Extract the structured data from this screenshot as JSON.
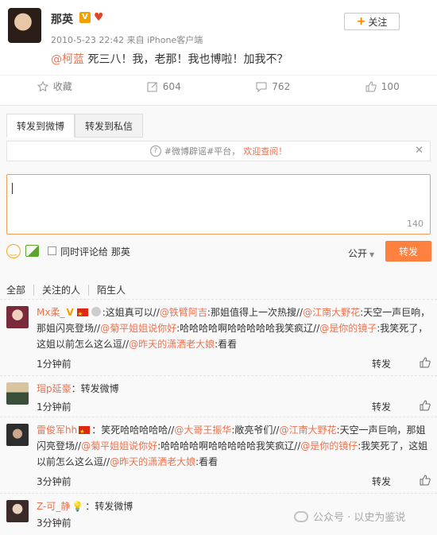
{
  "post": {
    "author": "那英",
    "verified_badge": "V",
    "meta": "2010-5-23 22:42 来自 iPhone客户端",
    "follow_label": "关注",
    "text_mention": "@柯蓝",
    "text_body": " 死三八！我，老那！我也博啦！加我不？"
  },
  "actions": {
    "favorite": "收藏",
    "repost_count": "604",
    "comment_count": "762",
    "like_count": "100"
  },
  "repost_panel": {
    "tab_weibo": "转发到微博",
    "tab_private": "转发到私信",
    "tip_prefix": "#微博辟谣#平台，",
    "tip_highlight": "欢迎查阅！",
    "counter": "140",
    "also_comment_label": "同时评论给 那英",
    "visibility": "公开",
    "submit_label": "转发"
  },
  "filters": [
    "全部",
    "关注的人",
    "陌生人"
  ],
  "comments": [
    {
      "user": "Mx柔_",
      "text": ":这姐真可以//",
      "mentions": [
        {
          "m": "@铁臂阿吉",
          "t": ":那姐值得上一次热搜//"
        },
        {
          "m": "@江南大野花",
          "t": ":天空一声巨响，那姐闪亮登场//"
        },
        {
          "m": "@菊平姐姐说你好",
          "t": ":哈哈哈哈啊哈哈哈哈哈我笑疯辽//"
        },
        {
          "m": "@是你的镜子",
          "t": ":我笑死了，这姐以前怎么这么逗//"
        },
        {
          "m": "@昨天的潇洒老大娘",
          "t": ":看看"
        }
      ],
      "time": "1分钟前",
      "forward": "转发"
    },
    {
      "user": "瑁p延豪",
      "text": "：转发微博",
      "time": "1分钟前",
      "forward": "转发"
    },
    {
      "user": "雷俊军hh",
      "text": "：笑死哈哈哈哈哈//",
      "mentions": [
        {
          "m": "@大哥王振华",
          "t": ":敞亮爷们//"
        },
        {
          "m": "@江南大野花",
          "t": ":天空一声巨响，那姐闪亮登场//"
        },
        {
          "m": "@菊平姐姐说你好",
          "t": ":哈哈哈哈啊哈哈哈哈哈我笑疯辽//"
        },
        {
          "m": "@是你的镜仔",
          "t": ":我笑死了，这姐以前怎么这么逗//"
        },
        {
          "m": "@昨天的潇洒老大娘",
          "t": ":看看"
        }
      ],
      "time": "3分钟前",
      "forward": "转发"
    },
    {
      "user": "Z-可_静",
      "text": "：转发微博",
      "time": "3分钟前"
    }
  ],
  "watermark": "公众号 · 以史为鉴说"
}
